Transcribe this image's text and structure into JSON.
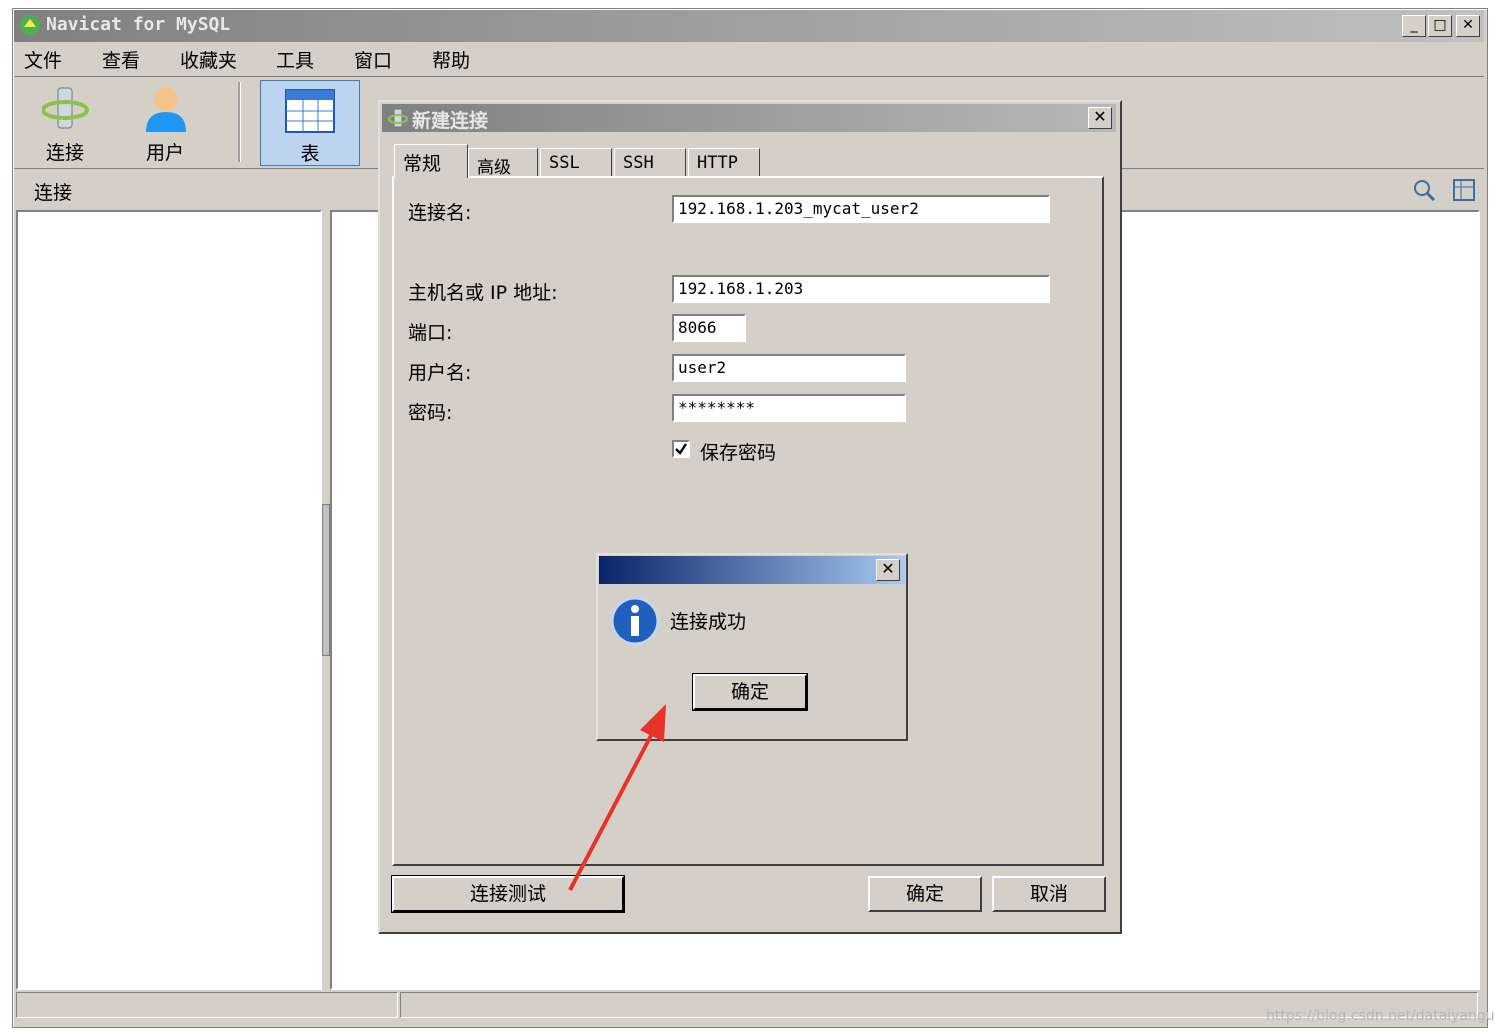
{
  "app": {
    "title": "Navicat for MySQL"
  },
  "menu": [
    "文件",
    "查看",
    "收藏夹",
    "工具",
    "窗口",
    "帮助"
  ],
  "toolbar": {
    "connect_label": "连接",
    "user_label": "用户",
    "table_label": "表"
  },
  "sidebar": {
    "header": "连接"
  },
  "dialog": {
    "title": "新建连接",
    "tabs": [
      "常规",
      "高级",
      "SSL",
      "SSH",
      "HTTP"
    ],
    "active_tab": "常规",
    "fields": {
      "conn_name_label": "连接名:",
      "conn_name_value": "192.168.1.203_mycat_user2",
      "host_label": "主机名或 IP 地址:",
      "host_value": "192.168.1.203",
      "port_label": "端口:",
      "port_value": "8066",
      "user_label": "用户名:",
      "user_value": "user2",
      "password_label": "密码:",
      "password_value": "********",
      "save_password_label": "保存密码",
      "save_password_checked": true
    },
    "buttons": {
      "test": "连接测试",
      "ok": "确定",
      "cancel": "取消"
    }
  },
  "message_box": {
    "text": "连接成功",
    "ok": "确定",
    "icon": "info-icon"
  },
  "watermark": "https://blog.csdn.net/dataiyangu",
  "colors": {
    "annotation_arrow": "#e8322a",
    "message_titlebar": "#0a246a"
  }
}
